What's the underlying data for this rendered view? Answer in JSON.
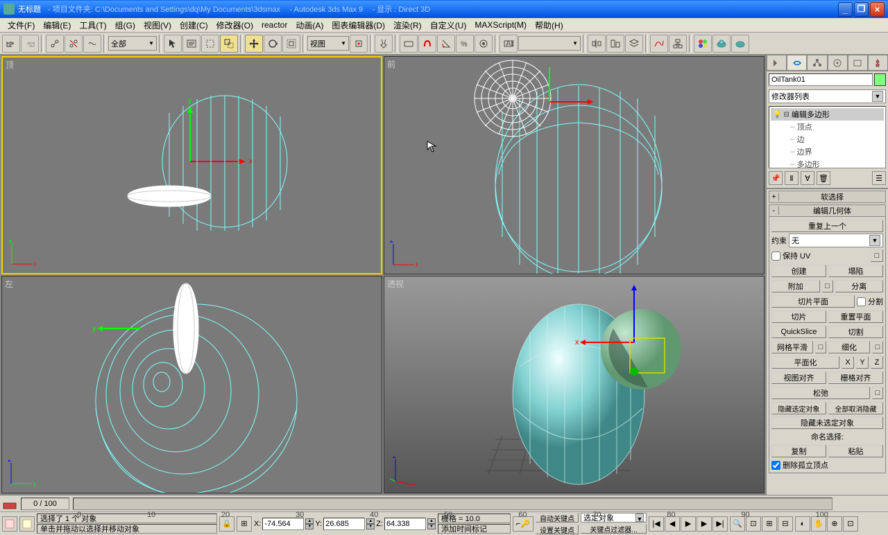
{
  "titlebar": {
    "untitled": "无标题",
    "project": "- 项目文件夹: C:\\Documents and Settings\\dq\\My Documents\\3dsmax",
    "app": "- Autodesk 3ds Max 9",
    "display": "- 显示 : Direct 3D"
  },
  "menu": [
    "文件(F)",
    "编辑(E)",
    "工具(T)",
    "组(G)",
    "视图(V)",
    "创建(C)",
    "修改器(O)",
    "reactor",
    "动画(A)",
    "图表编辑器(D)",
    "渲染(R)",
    "自定义(U)",
    "MAXScript(M)",
    "帮助(H)"
  ],
  "toolbar": {
    "selectionFilter": "全部",
    "coordSystem": "视图"
  },
  "viewports": {
    "top": "顶",
    "front": "前",
    "left": "左",
    "perspective": "透视"
  },
  "sidepanel": {
    "objectName": "OilTank01",
    "modifierList": "修改器列表",
    "stack": {
      "editPoly": "编辑多边形",
      "vertex": "顶点",
      "edge": "边",
      "border": "边界",
      "polygon": "多边形"
    },
    "rollups": {
      "softSelection": "软选择",
      "editGeometry": "编辑几何体",
      "repeatLast": "重复上一个",
      "constraint": "约束",
      "constraintValue": "无",
      "preserveUV": "保持  UV",
      "create": "创建",
      "collapse": "塌陷",
      "attach": "附加",
      "detach": "分离",
      "slicePlane": "切片平面",
      "split": "分割",
      "slice": "切片",
      "resetPlane": "重置平面",
      "quickSlice": "QuickSlice",
      "cut": "切割",
      "msmooth": "网格平滑",
      "tessellate": "细化",
      "makePlanar": "平面化",
      "viewAlign": "视图对齐",
      "gridAlign": "栅格对齐",
      "relax": "松弛",
      "hideSelected": "隐藏选定对象",
      "unhideAll": "全部取消隐藏",
      "hideUnselected": "隐藏未选定对象",
      "namedSelections": "命名选择:",
      "copy": "复制",
      "paste": "粘贴",
      "deleteIsolated": "删除孤立顶点"
    }
  },
  "timeline": {
    "frame": "0 / 100",
    "ticks": [
      "0",
      "10",
      "20",
      "30",
      "40",
      "50",
      "60",
      "70",
      "80",
      "90",
      "100"
    ]
  },
  "statusbar": {
    "selected": "选择了 1 个 对象",
    "hint": "单击并拖动以选择并移动对象",
    "x": "-74.564",
    "y": "26.685",
    "z": "64.338",
    "grid": "栅格 = 10.0",
    "addTimeTag": "添加时间标记",
    "autoKey": "自动关键点",
    "setKey": "设置关键点",
    "selectedObj": "选定对象",
    "keyFilters": "关键点过滤器..."
  }
}
